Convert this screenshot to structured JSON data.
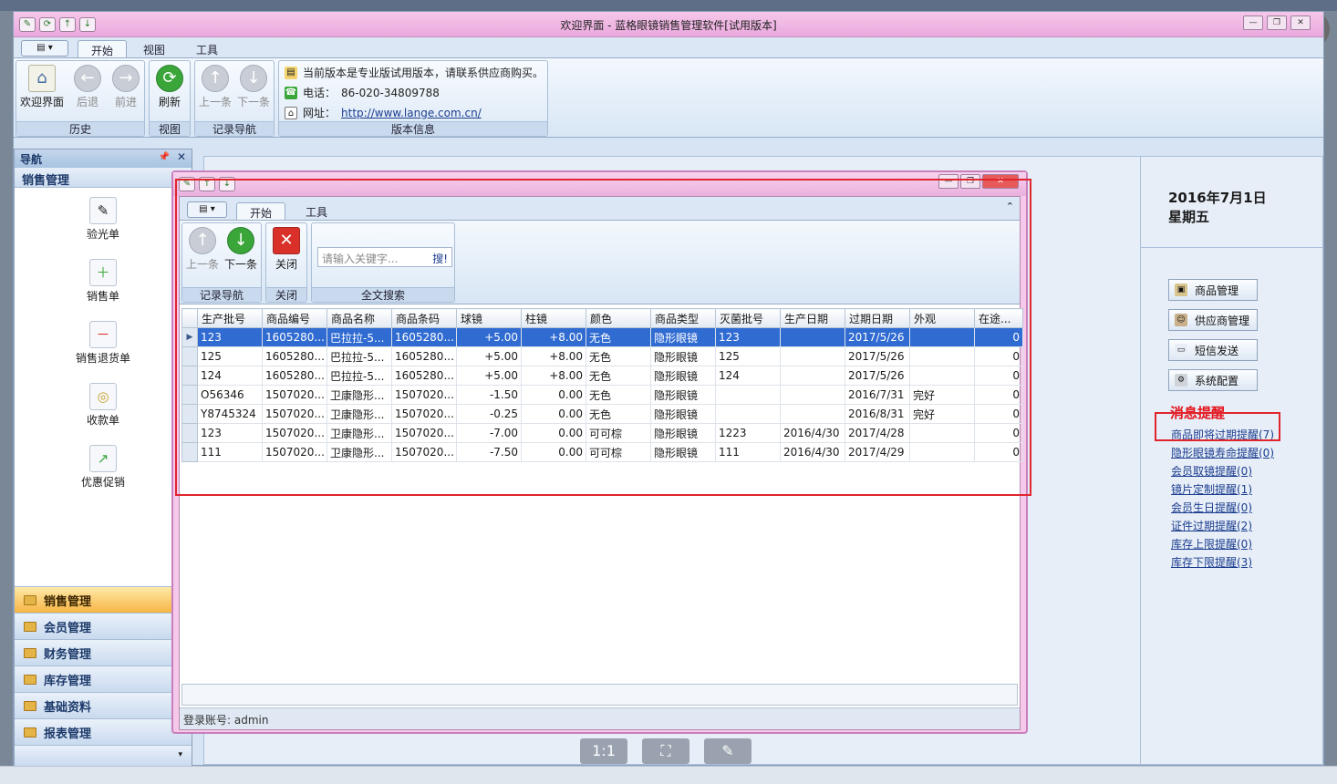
{
  "window": {
    "title": "欢迎界面 - 蓝格眼镜销售管理软件[试用版本]"
  },
  "ribbon": {
    "tabs": [
      "开始",
      "视图",
      "工具"
    ],
    "groups": {
      "history": {
        "label": "历史",
        "welcome": "欢迎界面",
        "back": "后退",
        "forward": "前进"
      },
      "view": {
        "label": "视图",
        "refresh": "刷新"
      },
      "record": {
        "label": "记录导航",
        "prev": "上一条",
        "next": "下一条"
      },
      "version": {
        "label": "版本信息",
        "notice": "当前版本是专业版试用版本，请联系供应商购买。",
        "phone_label": "电话：",
        "phone": "86-020-34809788",
        "site_label": "网址：",
        "site": "http://www.lange.com.cn/"
      }
    }
  },
  "nav": {
    "title": "导航",
    "section": "销售管理",
    "items": [
      "验光单",
      "销售单",
      "销售退货单",
      "收款单",
      "优惠促销"
    ],
    "sections": [
      "销售管理",
      "会员管理",
      "财务管理",
      "库存管理",
      "基础资料",
      "报表管理"
    ]
  },
  "welcome": {
    "date": "2016年7月1日",
    "weekday": "星期五",
    "buttons": [
      "商品管理",
      "供应商管理",
      "短信发送",
      "系统配置"
    ],
    "msg_title": "消息提醒",
    "links": [
      "商品即将过期提醒(7)",
      "隐形眼镜寿命提醒(0)",
      "会员取镜提醒(0)",
      "镜片定制提醒(1)",
      "会员生日提醒(0)",
      "证件过期提醒(2)",
      "库存上限提醒(0)",
      "库存下限提醒(3)"
    ]
  },
  "child": {
    "tabs": [
      "开始",
      "工具"
    ],
    "record_label": "记录导航",
    "prev": "上一条",
    "next": "下一条",
    "close_label": "关闭",
    "close_btn": "关闭",
    "search_label": "全文搜索",
    "search_placeholder": "请输入关键字...",
    "search_btn": "搜!",
    "status": "登录账号: admin",
    "columns": [
      "生产批号",
      "商品编号",
      "商品名称",
      "商品条码",
      "球镜",
      "柱镜",
      "颜色",
      "商品类型",
      "灭菌批号",
      "生产日期",
      "过期日期",
      "外观",
      "在途..."
    ],
    "rows": [
      [
        "123",
        "1605280...",
        "巴拉拉-5...",
        "1605280...",
        "+5.00",
        "+8.00",
        "无色",
        "隐形眼镜",
        "123",
        "",
        "2017/5/26",
        "",
        "0"
      ],
      [
        "125",
        "1605280...",
        "巴拉拉-5...",
        "1605280...",
        "+5.00",
        "+8.00",
        "无色",
        "隐形眼镜",
        "125",
        "",
        "2017/5/26",
        "",
        "0"
      ],
      [
        "124",
        "1605280...",
        "巴拉拉-5...",
        "1605280...",
        "+5.00",
        "+8.00",
        "无色",
        "隐形眼镜",
        "124",
        "",
        "2017/5/26",
        "",
        "0"
      ],
      [
        "O56346",
        "1507020...",
        "卫康隐形...",
        "1507020...",
        "-1.50",
        "0.00",
        "无色",
        "隐形眼镜",
        "",
        "",
        "2016/7/31",
        "完好",
        "0"
      ],
      [
        "Y8745324",
        "1507020...",
        "卫康隐形...",
        "1507020...",
        "-0.25",
        "0.00",
        "无色",
        "隐形眼镜",
        "",
        "",
        "2016/8/31",
        "完好",
        "0"
      ],
      [
        "123",
        "1507020...",
        "卫康隐形...",
        "1507020...",
        "-7.00",
        "0.00",
        "可可棕",
        "隐形眼镜",
        "1223",
        "2016/4/30",
        "2017/4/28",
        "",
        "0"
      ],
      [
        "111",
        "1507020...",
        "卫康隐形...",
        "1507020...",
        "-7.50",
        "0.00",
        "可可棕",
        "隐形眼镜",
        "111",
        "2016/4/30",
        "2017/4/29",
        "",
        "0"
      ]
    ]
  },
  "viewer": {
    "zoom_label": "1:1"
  }
}
